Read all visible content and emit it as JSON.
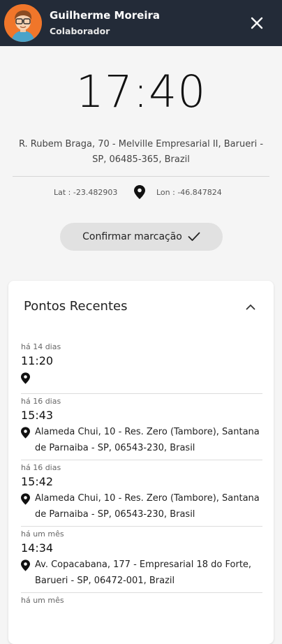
{
  "header": {
    "user_name": "Guilherme Moreira",
    "user_role": "Colaborador"
  },
  "clock": {
    "time": "17:40"
  },
  "location": {
    "address": "R. Rubem Braga, 70 - Melville Empresarial II, Barueri - SP, 06485-365, Brazil",
    "lat": "Lat : -23.482903",
    "lon": "Lon : -46.847824"
  },
  "confirm": {
    "label": "Confirmar marcação"
  },
  "recent": {
    "title": "Pontos Recentes",
    "entries": [
      {
        "when": "há 14 dias",
        "time": "11:20",
        "address": ""
      },
      {
        "when": "há 16 dias",
        "time": "15:43",
        "address": "Alameda Chui, 10 - Res. Zero (Tambore), Santana de Parnaiba - SP, 06543-230, Brasil"
      },
      {
        "when": "há 16 dias",
        "time": "15:42",
        "address": "Alameda Chui, 10 - Res. Zero (Tambore), Santana de Parnaiba - SP, 06543-230, Brasil"
      },
      {
        "when": "há um mês",
        "time": "14:34",
        "address": "Av. Copacabana, 177 - Empresarial 18 do Forte, Barueri - SP, 06472-001, Brazil"
      },
      {
        "when": "há um mês",
        "time": "",
        "address": ""
      }
    ]
  },
  "colors": {
    "header_bg": "#232b38",
    "avatar_bg": "#f0762a",
    "button_bg": "#e1e1e1"
  }
}
